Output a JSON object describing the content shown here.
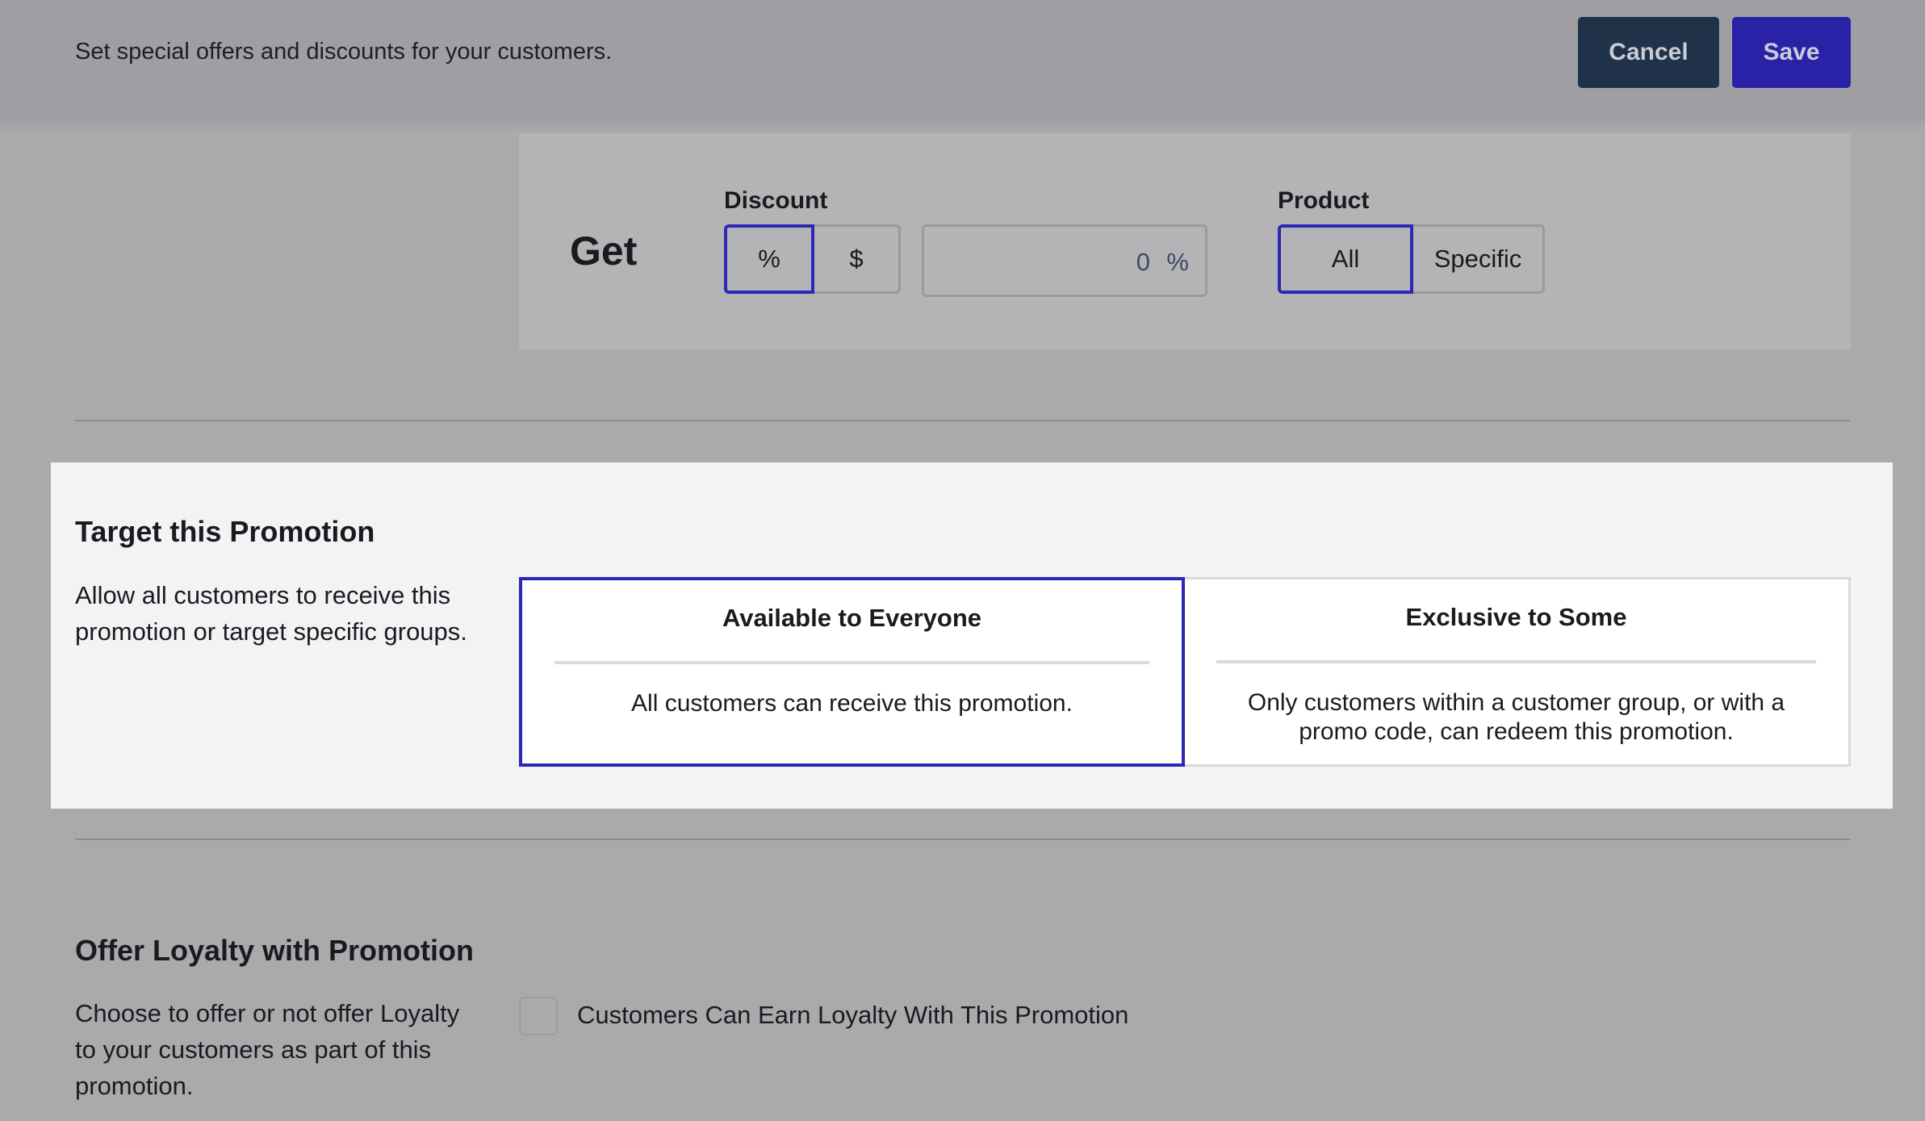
{
  "header": {
    "subtitle": "Set special offers and discounts for your customers.",
    "cancel_label": "Cancel",
    "save_label": "Save",
    "cancel_color": "#1f3249",
    "save_color": "#2a22a6"
  },
  "get": {
    "title": "Get",
    "discount": {
      "label": "Discount",
      "options": [
        "%",
        "$"
      ],
      "selected": "%",
      "amount_value": "0",
      "amount_unit": "%"
    },
    "product": {
      "label": "Product",
      "options": [
        "All",
        "Specific"
      ],
      "selected": "All"
    }
  },
  "target": {
    "title": "Target this Promotion",
    "description": "Allow all customers to receive this promotion or target specific groups.",
    "options": [
      {
        "title": "Available to Everyone",
        "description": "All customers can receive this promotion."
      },
      {
        "title": "Exclusive to Some",
        "description": "Only customers within a customer group, or with a promo code, can redeem this promotion."
      }
    ],
    "selected": "Available to Everyone",
    "accent_color": "#2d27b8"
  },
  "loyalty": {
    "title": "Offer Loyalty with Promotion",
    "description": "Choose to offer or not offer Loyalty to your customers as part of this promotion.",
    "checkbox_label": "Customers Can Earn Loyalty With This Promotion",
    "checked": false
  }
}
